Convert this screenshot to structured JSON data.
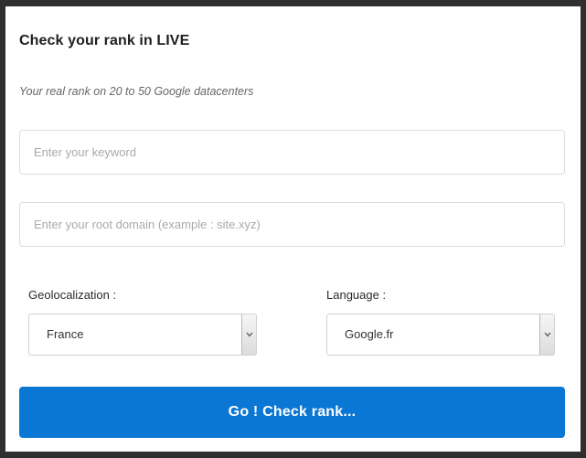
{
  "form": {
    "title": "Check your rank in LIVE",
    "subtitle": "Your real rank on 20 to 50 Google datacenters",
    "keyword_placeholder": "Enter your keyword",
    "domain_placeholder": "Enter your root domain (example : site.xyz)",
    "geolocalization_label": "Geolocalization :",
    "geolocalization_value": "France",
    "language_label": "Language :",
    "language_value": "Google.fr",
    "submit_label": "Go ! Check rank..."
  },
  "colors": {
    "page_background": "#2f2f2f",
    "card_background": "#ffffff",
    "button_accent": "#0a77d5"
  },
  "icons": {
    "select_arrow": "chevron-down-icon"
  }
}
